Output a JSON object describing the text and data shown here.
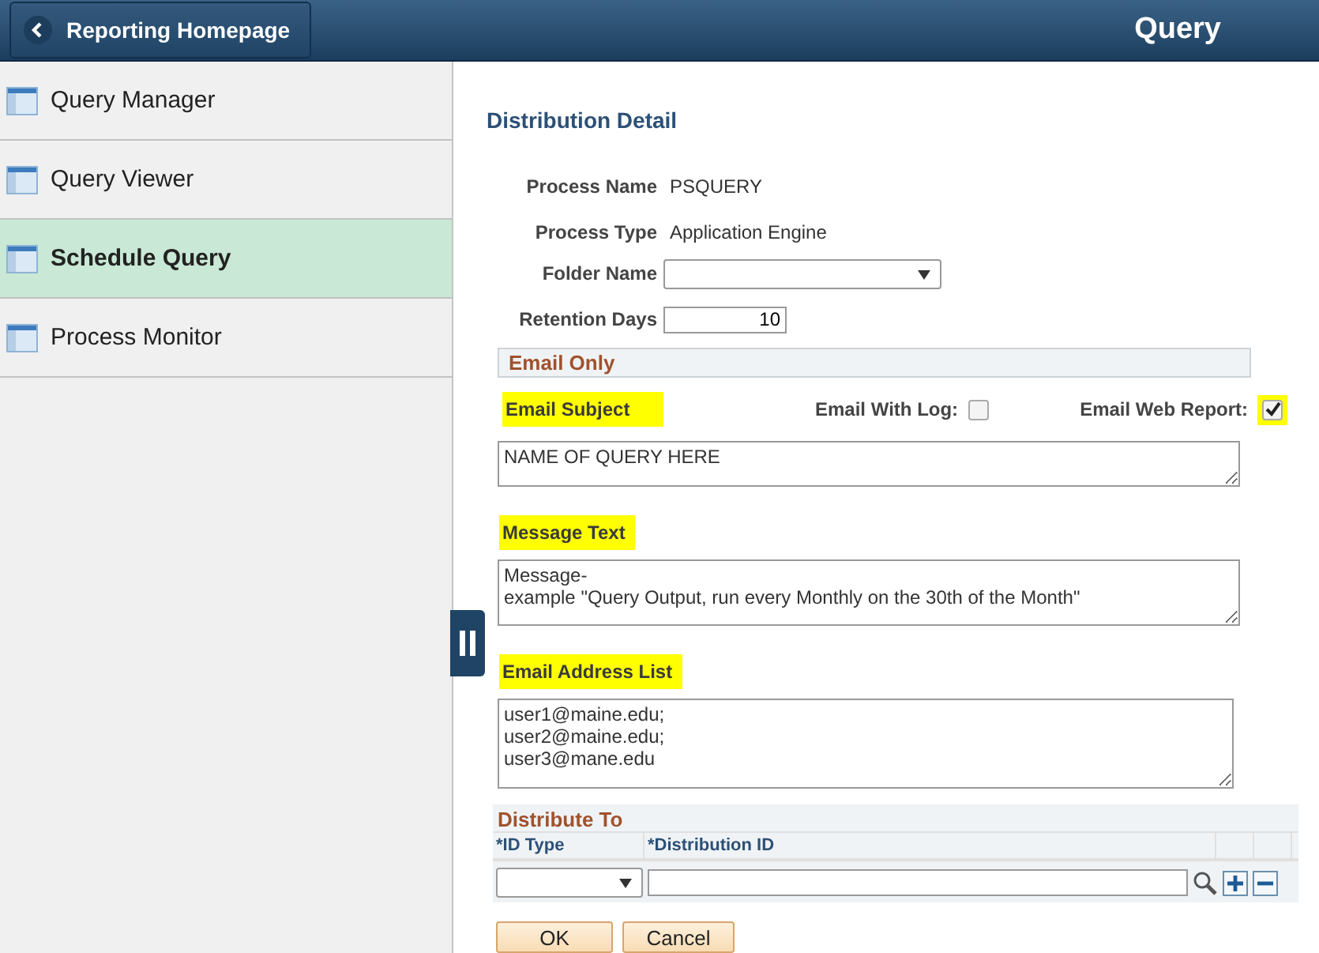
{
  "header": {
    "back_button": "Reporting Homepage",
    "title": "Query"
  },
  "sidebar": {
    "items": [
      {
        "label": "Query Manager",
        "selected": false
      },
      {
        "label": "Query Viewer",
        "selected": false
      },
      {
        "label": "Schedule Query",
        "selected": true
      },
      {
        "label": "Process Monitor",
        "selected": false
      }
    ]
  },
  "form": {
    "heading": "Distribution Detail",
    "fields": [
      {
        "kind": "text",
        "label": "Process Name",
        "value": "PSQUERY"
      },
      {
        "kind": "text",
        "label": "Process Type",
        "value": "Application Engine"
      },
      {
        "kind": "dropdown",
        "label": "Folder Name"
      },
      {
        "kind": "number",
        "label": "Retention Days",
        "value": "10"
      }
    ],
    "email_section": {
      "title": "Email Only",
      "subject_label": {
        "text": "Email Subject",
        "highlighted": true
      },
      "email_with_log": {
        "label": "Email With Log:",
        "checked": false
      },
      "email_web_report": {
        "label": "Email Web Report:",
        "checked": true,
        "highlighted": true
      },
      "subject_value": "NAME OF QUERY HERE",
      "message_label": {
        "text": "Message Text",
        "highlighted": true
      },
      "message_lines": [
        "Message-",
        "example \"Query Output, run every Monthly on the 30th of the Month\""
      ],
      "address_label": {
        "text": "Email Address List",
        "highlighted": true
      },
      "address_lines": [
        "user1@maine.edu;",
        "user2@maine.edu;",
        "user3@mane.edu"
      ]
    },
    "distribute": {
      "title": "Distribute To",
      "columns": [
        "*ID Type",
        "*Distribution ID"
      ]
    },
    "buttons": [
      "OK",
      "Cancel"
    ]
  }
}
